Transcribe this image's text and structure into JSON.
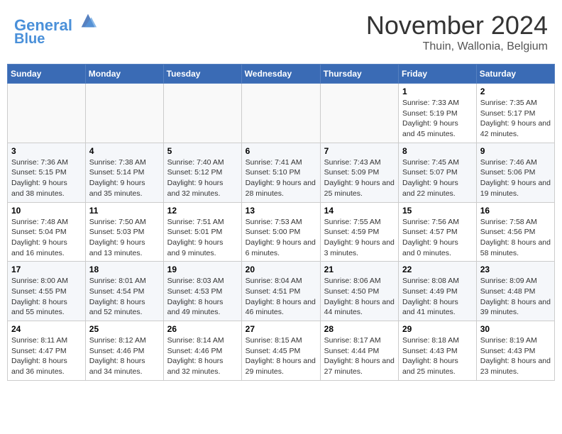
{
  "header": {
    "logo_line1": "General",
    "logo_line2": "Blue",
    "month_title": "November 2024",
    "subtitle": "Thuin, Wallonia, Belgium"
  },
  "days_of_week": [
    "Sunday",
    "Monday",
    "Tuesday",
    "Wednesday",
    "Thursday",
    "Friday",
    "Saturday"
  ],
  "weeks": [
    [
      {
        "day": "",
        "info": ""
      },
      {
        "day": "",
        "info": ""
      },
      {
        "day": "",
        "info": ""
      },
      {
        "day": "",
        "info": ""
      },
      {
        "day": "",
        "info": ""
      },
      {
        "day": "1",
        "info": "Sunrise: 7:33 AM\nSunset: 5:19 PM\nDaylight: 9 hours and 45 minutes."
      },
      {
        "day": "2",
        "info": "Sunrise: 7:35 AM\nSunset: 5:17 PM\nDaylight: 9 hours and 42 minutes."
      }
    ],
    [
      {
        "day": "3",
        "info": "Sunrise: 7:36 AM\nSunset: 5:15 PM\nDaylight: 9 hours and 38 minutes."
      },
      {
        "day": "4",
        "info": "Sunrise: 7:38 AM\nSunset: 5:14 PM\nDaylight: 9 hours and 35 minutes."
      },
      {
        "day": "5",
        "info": "Sunrise: 7:40 AM\nSunset: 5:12 PM\nDaylight: 9 hours and 32 minutes."
      },
      {
        "day": "6",
        "info": "Sunrise: 7:41 AM\nSunset: 5:10 PM\nDaylight: 9 hours and 28 minutes."
      },
      {
        "day": "7",
        "info": "Sunrise: 7:43 AM\nSunset: 5:09 PM\nDaylight: 9 hours and 25 minutes."
      },
      {
        "day": "8",
        "info": "Sunrise: 7:45 AM\nSunset: 5:07 PM\nDaylight: 9 hours and 22 minutes."
      },
      {
        "day": "9",
        "info": "Sunrise: 7:46 AM\nSunset: 5:06 PM\nDaylight: 9 hours and 19 minutes."
      }
    ],
    [
      {
        "day": "10",
        "info": "Sunrise: 7:48 AM\nSunset: 5:04 PM\nDaylight: 9 hours and 16 minutes."
      },
      {
        "day": "11",
        "info": "Sunrise: 7:50 AM\nSunset: 5:03 PM\nDaylight: 9 hours and 13 minutes."
      },
      {
        "day": "12",
        "info": "Sunrise: 7:51 AM\nSunset: 5:01 PM\nDaylight: 9 hours and 9 minutes."
      },
      {
        "day": "13",
        "info": "Sunrise: 7:53 AM\nSunset: 5:00 PM\nDaylight: 9 hours and 6 minutes."
      },
      {
        "day": "14",
        "info": "Sunrise: 7:55 AM\nSunset: 4:59 PM\nDaylight: 9 hours and 3 minutes."
      },
      {
        "day": "15",
        "info": "Sunrise: 7:56 AM\nSunset: 4:57 PM\nDaylight: 9 hours and 0 minutes."
      },
      {
        "day": "16",
        "info": "Sunrise: 7:58 AM\nSunset: 4:56 PM\nDaylight: 8 hours and 58 minutes."
      }
    ],
    [
      {
        "day": "17",
        "info": "Sunrise: 8:00 AM\nSunset: 4:55 PM\nDaylight: 8 hours and 55 minutes."
      },
      {
        "day": "18",
        "info": "Sunrise: 8:01 AM\nSunset: 4:54 PM\nDaylight: 8 hours and 52 minutes."
      },
      {
        "day": "19",
        "info": "Sunrise: 8:03 AM\nSunset: 4:53 PM\nDaylight: 8 hours and 49 minutes."
      },
      {
        "day": "20",
        "info": "Sunrise: 8:04 AM\nSunset: 4:51 PM\nDaylight: 8 hours and 46 minutes."
      },
      {
        "day": "21",
        "info": "Sunrise: 8:06 AM\nSunset: 4:50 PM\nDaylight: 8 hours and 44 minutes."
      },
      {
        "day": "22",
        "info": "Sunrise: 8:08 AM\nSunset: 4:49 PM\nDaylight: 8 hours and 41 minutes."
      },
      {
        "day": "23",
        "info": "Sunrise: 8:09 AM\nSunset: 4:48 PM\nDaylight: 8 hours and 39 minutes."
      }
    ],
    [
      {
        "day": "24",
        "info": "Sunrise: 8:11 AM\nSunset: 4:47 PM\nDaylight: 8 hours and 36 minutes."
      },
      {
        "day": "25",
        "info": "Sunrise: 8:12 AM\nSunset: 4:46 PM\nDaylight: 8 hours and 34 minutes."
      },
      {
        "day": "26",
        "info": "Sunrise: 8:14 AM\nSunset: 4:46 PM\nDaylight: 8 hours and 32 minutes."
      },
      {
        "day": "27",
        "info": "Sunrise: 8:15 AM\nSunset: 4:45 PM\nDaylight: 8 hours and 29 minutes."
      },
      {
        "day": "28",
        "info": "Sunrise: 8:17 AM\nSunset: 4:44 PM\nDaylight: 8 hours and 27 minutes."
      },
      {
        "day": "29",
        "info": "Sunrise: 8:18 AM\nSunset: 4:43 PM\nDaylight: 8 hours and 25 minutes."
      },
      {
        "day": "30",
        "info": "Sunrise: 8:19 AM\nSunset: 4:43 PM\nDaylight: 8 hours and 23 minutes."
      }
    ]
  ]
}
